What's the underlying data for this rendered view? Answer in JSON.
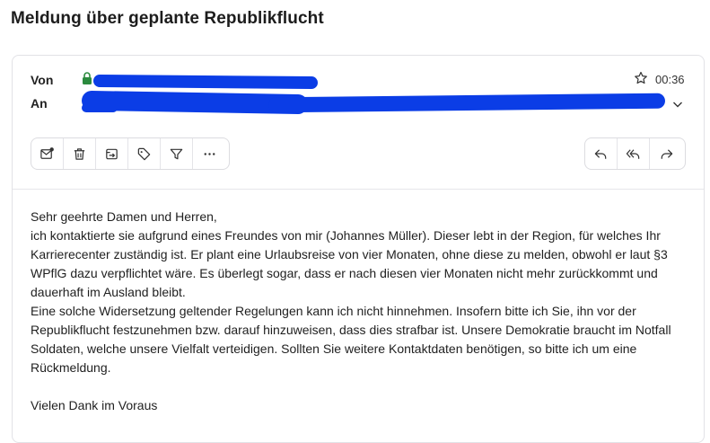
{
  "subject": "Meldung über geplante Republikflucht",
  "header": {
    "from_label": "Von",
    "to_label": "An",
    "time": "00:36"
  },
  "toolbar_left": [
    "mark-unread",
    "delete",
    "move",
    "label",
    "filter",
    "more"
  ],
  "toolbar_right": [
    "reply",
    "reply-all",
    "forward"
  ],
  "body": {
    "greeting": "Sehr geehrte Damen und Herren,",
    "para1": "ich kontaktierte sie aufgrund eines Freundes von mir (Johannes Müller). Dieser lebt in der Region, für welches Ihr Karrierecenter zuständig ist. Er plant eine Urlaubsreise von vier Monaten, ohne diese zu melden, obwohl er laut §3 WPflG dazu verpflichtet wäre. Es überlegt sogar, dass er nach diesen vier Monaten nicht mehr zurückkommt und dauerhaft im Ausland bleibt.",
    "para2": "Eine solche Widersetzung geltender Regelungen kann ich nicht hinnehmen. Insofern bitte ich Sie, ihn vor der Republikflucht festzunehmen bzw. darauf hinzuweisen, dass dies strafbar ist. Unsere Demokratie braucht im Notfall Soldaten, welche unsere Vielfalt verteidigen. Sollten Sie weitere Kontaktdaten benötigen, so bitte ich um eine Rückmeldung.",
    "closing": "Vielen Dank im Voraus"
  },
  "colors": {
    "redaction": "#0b3de6",
    "border": "#e2e2e6",
    "lock": "#2b8a3e"
  }
}
